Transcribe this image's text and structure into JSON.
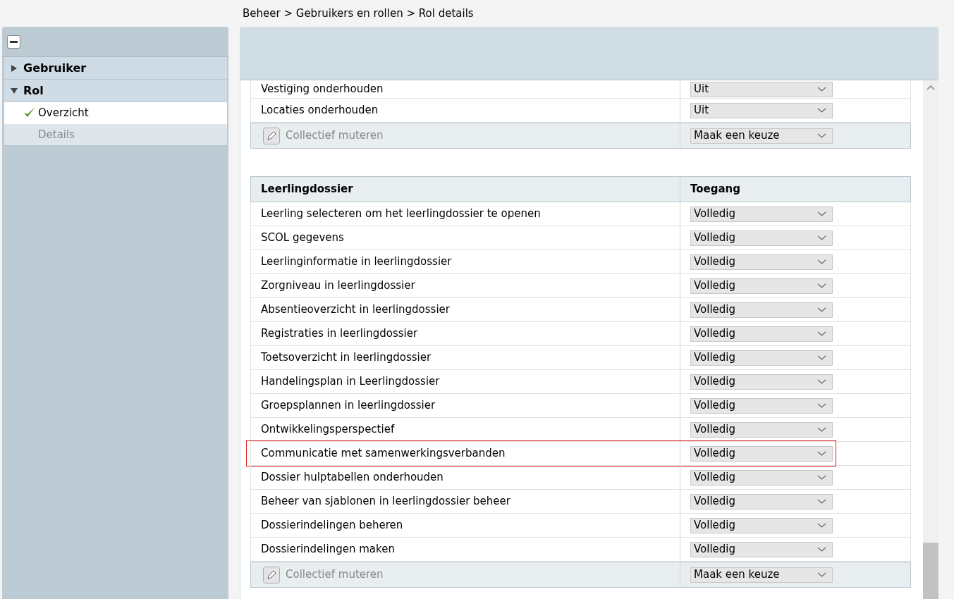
{
  "breadcrumb": "Beheer > Gebruikers en rollen > Rol details",
  "sidebar": {
    "groups": [
      {
        "label": "Gebruiker",
        "expanded": false
      },
      {
        "label": "Rol",
        "expanded": true,
        "items": [
          {
            "label": "Overzicht",
            "selected": true,
            "done": true
          },
          {
            "label": "Details",
            "selected": false,
            "done": false
          }
        ]
      }
    ]
  },
  "sections": [
    {
      "rows": [
        {
          "kind": "setting",
          "label": "Vestiging onderhouden",
          "value": "Uit",
          "highlighted": false
        },
        {
          "kind": "setting",
          "label": "Locaties onderhouden",
          "value": "Uit",
          "highlighted": false
        },
        {
          "kind": "bulk",
          "label": "Collectief muteren",
          "value": "Maak een keuze",
          "highlighted": false
        }
      ]
    },
    {
      "header": {
        "column_1": "Leerlingdossier",
        "column_2": "Toegang"
      },
      "rows": [
        {
          "kind": "setting",
          "label": "Leerling selecteren om het leerlingdossier te openen",
          "value": "Volledig",
          "highlighted": false
        },
        {
          "kind": "setting",
          "label": "SCOL gegevens",
          "value": "Volledig",
          "highlighted": false
        },
        {
          "kind": "setting",
          "label": "Leerlinginformatie in leerlingdossier",
          "value": "Volledig",
          "highlighted": false
        },
        {
          "kind": "setting",
          "label": "Zorgniveau in leerlingdossier",
          "value": "Volledig",
          "highlighted": false
        },
        {
          "kind": "setting",
          "label": "Absentieoverzicht in leerlingdossier",
          "value": "Volledig",
          "highlighted": false
        },
        {
          "kind": "setting",
          "label": "Registraties in leerlingdossier",
          "value": "Volledig",
          "highlighted": false
        },
        {
          "kind": "setting",
          "label": "Toetsoverzicht in leerlingdossier",
          "value": "Volledig",
          "highlighted": false
        },
        {
          "kind": "setting",
          "label": "Handelingsplan in Leerlingdossier",
          "value": "Volledig",
          "highlighted": false
        },
        {
          "kind": "setting",
          "label": "Groepsplannen in leerlingdossier",
          "value": "Volledig",
          "highlighted": false
        },
        {
          "kind": "setting",
          "label": "Ontwikkelingsperspectief",
          "value": "Volledig",
          "highlighted": false
        },
        {
          "kind": "setting",
          "label": "Communicatie met samenwerkingsverbanden",
          "value": "Volledig",
          "highlighted": true
        },
        {
          "kind": "setting",
          "label": "Dossier hulptabellen onderhouden",
          "value": "Volledig",
          "highlighted": false
        },
        {
          "kind": "setting",
          "label": "Beheer van sjablonen in leerlingdossier beheer",
          "value": "Volledig",
          "highlighted": false
        },
        {
          "kind": "setting",
          "label": "Dossierindelingen beheren",
          "value": "Volledig",
          "highlighted": false
        },
        {
          "kind": "setting",
          "label": "Dossierindelingen maken",
          "value": "Volledig",
          "highlighted": false
        },
        {
          "kind": "bulk",
          "label": "Collectief muteren",
          "value": "Maak een keuze",
          "highlighted": false
        }
      ]
    }
  ]
}
